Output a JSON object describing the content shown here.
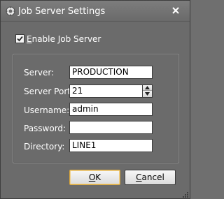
{
  "window": {
    "title": "Job Server Settings",
    "icon": "gear-icon",
    "close_icon": "close-icon"
  },
  "enable": {
    "checked": true,
    "label_mnemonic": "E",
    "label_rest": "nable Job Server"
  },
  "form": {
    "server_label": "Server:",
    "server_value": "PRODUCTION",
    "port_label": "Server Port:",
    "port_value": "21",
    "username_label": "Username:",
    "username_value": "admin",
    "password_label": "Password:",
    "password_value": "",
    "directory_label": "Directory:",
    "directory_value": "LINE1"
  },
  "buttons": {
    "ok_mnemonic": "O",
    "ok_rest": "K",
    "cancel_mnemonic": "C",
    "cancel_rest": "ancel"
  },
  "colors": {
    "dialog_bg": "#6b6b6b",
    "ok_focus_border": "#d9a63a",
    "field_bg": "#ffffff"
  }
}
